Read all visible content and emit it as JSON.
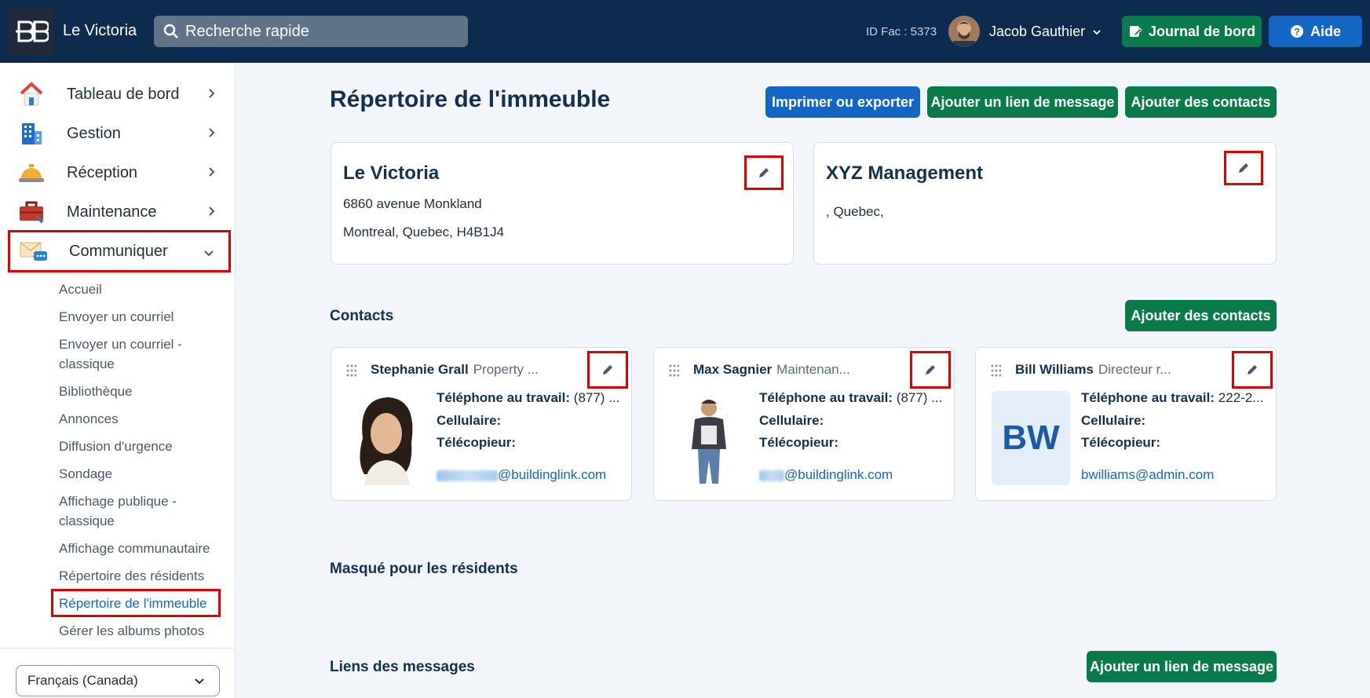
{
  "topbar": {
    "app_name": "Le Victoria",
    "search_placeholder": "Recherche rapide",
    "fac_id": "ID Fac : 5373",
    "user_name": "Jacob Gauthier",
    "journal_label": "Journal de bord",
    "help_label": "Aide"
  },
  "sidebar": {
    "items": [
      {
        "label": "Tableau de bord"
      },
      {
        "label": "Gestion"
      },
      {
        "label": "Réception"
      },
      {
        "label": "Maintenance"
      },
      {
        "label": "Communiquer"
      }
    ],
    "subitems": [
      "Accueil",
      "Envoyer un courriel",
      "Envoyer un courriel - classique",
      "Bibliothèque",
      "Annonces",
      "Diffusion d'urgence",
      "Sondage",
      "Affichage publique - classique",
      "Affichage communautaire",
      "Répertoire des résidents",
      "Répertoire de l'immeuble",
      "Gérer les albums photos"
    ],
    "language": "Français (Canada)"
  },
  "main": {
    "title": "Répertoire de l'immeuble",
    "print_label": "Imprimer ou exporter",
    "add_link_label": "Ajouter un lien de message",
    "add_contacts_label": "Ajouter des contacts",
    "building": {
      "name": "Le Victoria",
      "address1": "6860 avenue Monkland",
      "address2": "Montreal, Quebec, H4B1J4"
    },
    "management": {
      "name": "XYZ Management",
      "address": ", Quebec,"
    },
    "contacts_heading": "Contacts",
    "contacts_add_label": "Ajouter des contacts",
    "contacts": [
      {
        "name": "Stephanie Grall",
        "role": "Property ...",
        "work_phone_label": "Téléphone au travail:",
        "work_phone": "(877) ...",
        "cell_label": "Cellulaire:",
        "fax_label": "Télécopieur:",
        "email_domain": "@buildinglink.com"
      },
      {
        "name": "Max Sagnier",
        "role": "Maintenan...",
        "work_phone_label": "Téléphone au travail:",
        "work_phone": "(877) ...",
        "cell_label": "Cellulaire:",
        "fax_label": "Télécopieur:",
        "email_domain": "@buildinglink.com"
      },
      {
        "name": "Bill Williams",
        "role": "Directeur r...",
        "initials": "BW",
        "work_phone_label": "Téléphone au travail:",
        "work_phone": "222-2...",
        "cell_label": "Cellulaire:",
        "fax_label": "Télécopieur:",
        "email": "bwilliams@admin.com"
      }
    ],
    "hidden_heading": "Masqué pour les résidents",
    "links_heading": "Liens des messages",
    "links_add_label": "Ajouter un lien de message"
  }
}
